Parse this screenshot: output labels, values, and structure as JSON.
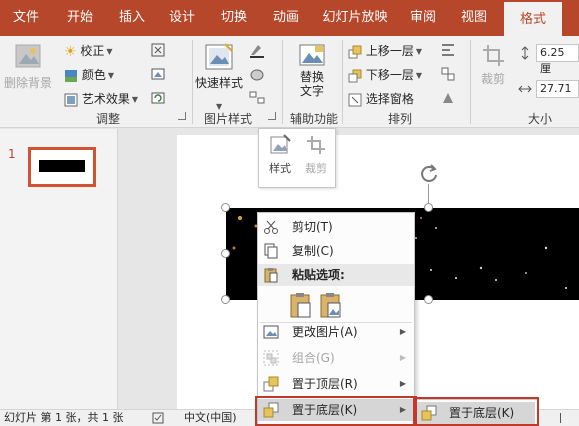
{
  "tabs": [
    "文件",
    "开始",
    "插入",
    "设计",
    "切换",
    "动画",
    "幻灯片放映",
    "审阅",
    "视图",
    "格式"
  ],
  "active_tab": "格式",
  "ribbon": {
    "remove_bg": "删除背景",
    "correction": "校正",
    "color": "颜色",
    "art_effects": "艺术效果",
    "quick_styles": "快速样式",
    "alt_text_line1": "替换",
    "alt_text_line2": "文字",
    "bring_forward": "上移一层",
    "send_backward": "下移一层",
    "selection_pane": "选择窗格",
    "crop": "裁剪",
    "height": "6.25 厘",
    "width": "27.71",
    "groups": {
      "adjust": "调整",
      "picture_styles": "图片样式",
      "accessibility": "辅助功能",
      "arrange": "排列",
      "size": "大小"
    }
  },
  "thumbnail": {
    "number": "1"
  },
  "mini_toolbar": {
    "style": "样式",
    "crop": "裁剪"
  },
  "context_menu": {
    "cut": "剪切(T)",
    "copy": "复制(C)",
    "paste_options": "粘贴选项:",
    "change_picture": "更改图片(A)",
    "group": "组合(G)",
    "bring_to_front": "置于顶层(R)",
    "send_to_back": "置于底层(K)"
  },
  "submenu": {
    "send_to_back": "置于底层(K)"
  },
  "statusbar": {
    "slide_info": "幻灯片 第 1 张，共 1 张",
    "language": "中文(中国)"
  },
  "colors": {
    "accent": "#b7472a",
    "highlight": "#c0392b"
  }
}
